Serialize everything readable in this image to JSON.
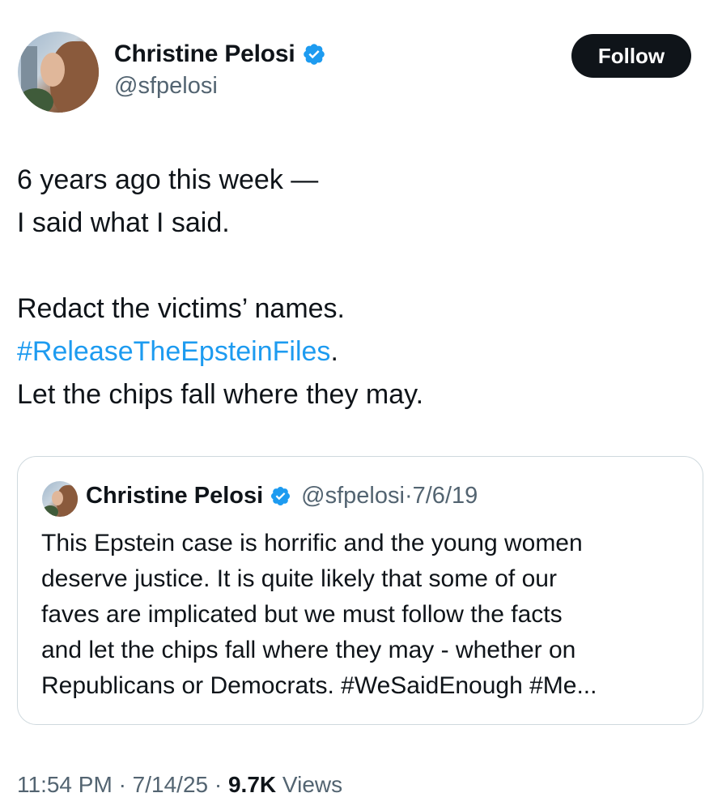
{
  "author": {
    "display_name": "Christine Pelosi",
    "handle": "@sfpelosi",
    "verified_icon": "verified-badge-icon"
  },
  "follow_label": "Follow",
  "tweet": {
    "line1": "6 years ago this week —",
    "line2": "I said what I said.",
    "line3": "Redact the victims’ names.",
    "hashtag": "#ReleaseTheEpsteinFiles",
    "hashtag_suffix": ".",
    "line5": "Let the chips fall where they may."
  },
  "quote": {
    "display_name": "Christine Pelosi",
    "handle": "@sfpelosi",
    "separator": "·",
    "date": "7/6/19",
    "lines": [
      "This Epstein case is horrific and the young women",
      "deserve justice. It is quite likely that some of our",
      "faves are implicated but we must follow the facts",
      "and let the chips fall where they may - whether on",
      "Republicans or Democrats. #WeSaidEnough #Me..."
    ]
  },
  "footer": {
    "time": "11:54 PM",
    "sep1": "·",
    "date": "7/14/25",
    "sep2": "·",
    "views_count": "9.7K",
    "views_label": "Views"
  },
  "colors": {
    "accent": "#1d9bf0",
    "text": "#0f1419",
    "muted": "#536471",
    "border": "#cfd9de"
  }
}
